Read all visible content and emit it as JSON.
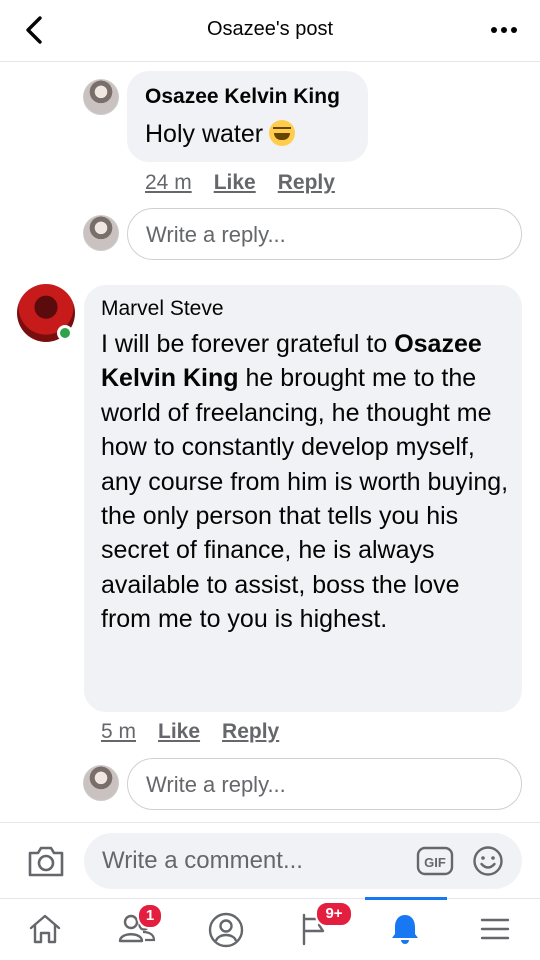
{
  "header": {
    "title": "Osazee's post",
    "back_icon": "chevron-left-icon",
    "more_icon": "more-horizontal-icon"
  },
  "comments": [
    {
      "author": "Osazee Kelvin King",
      "text": "Holy water",
      "emoji": "face-with-tears-of-joy",
      "time": "24 m",
      "like_label": "Like",
      "reply_label": "Reply"
    },
    {
      "author": "Marvel Steve",
      "text_before": "I will be forever grateful to ",
      "mention": "Osazee Kelvin King",
      "text_after": " he brought me to the world of freelancing, he thought me how to constantly develop myself, any course from him is worth buying, the only person that tells you his secret of finance, he is always available to assist, boss the love from me to you is highest.",
      "time": "5 m",
      "like_label": "Like",
      "reply_label": "Reply"
    }
  ],
  "reply_inputs": [
    {
      "placeholder": "Write a reply..."
    },
    {
      "placeholder": "Write a reply..."
    }
  ],
  "comment_bar": {
    "placeholder": "Write a comment...",
    "camera_icon": "camera-icon",
    "gif_label": "GIF",
    "smile_icon": "smile-icon"
  },
  "nav": {
    "items": [
      {
        "icon": "home-icon"
      },
      {
        "icon": "friends-icon",
        "badge": "1"
      },
      {
        "icon": "profile-icon"
      },
      {
        "icon": "pages-icon",
        "badge": "9+"
      },
      {
        "icon": "bell-icon",
        "active": true
      },
      {
        "icon": "menu-icon"
      }
    ]
  },
  "colors": {
    "accent": "#1877f2",
    "badge": "#e41e3f",
    "online": "#31a24c",
    "bubble": "#f0f2f5",
    "secondary_text": "#65676b"
  }
}
